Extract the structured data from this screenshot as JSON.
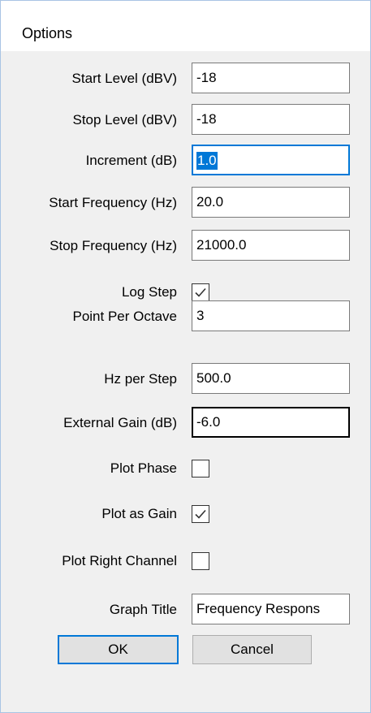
{
  "window": {
    "title": "Options"
  },
  "fields": {
    "start_level": {
      "label": "Start Level (dBV)",
      "value": "-18"
    },
    "stop_level": {
      "label": "Stop Level (dBV)",
      "value": "-18"
    },
    "increment": {
      "label": "Increment (dB)",
      "value": "1.0"
    },
    "start_frequency": {
      "label": "Start Frequency (Hz)",
      "value": "20.0"
    },
    "stop_frequency": {
      "label": "Stop Frequency (Hz)",
      "value": "21000.0"
    },
    "log_step": {
      "label": "Log Step",
      "checked": true
    },
    "points_per_octave": {
      "label": "Point Per Octave",
      "value": "3"
    },
    "hz_per_step": {
      "label": "Hz per Step",
      "value": "500.0"
    },
    "external_gain": {
      "label": "External Gain (dB)",
      "value": "-6.0"
    },
    "plot_phase": {
      "label": "Plot Phase",
      "checked": false
    },
    "plot_as_gain": {
      "label": "Plot as Gain",
      "checked": true
    },
    "plot_right_channel": {
      "label": "Plot Right Channel",
      "checked": false
    },
    "graph_title": {
      "label": "Graph Title",
      "value": "Frequency Respons"
    }
  },
  "buttons": {
    "ok": "OK",
    "cancel": "Cancel"
  },
  "colors": {
    "focus_accent": "#0078d7",
    "dialog_background": "#f0f0f0"
  }
}
